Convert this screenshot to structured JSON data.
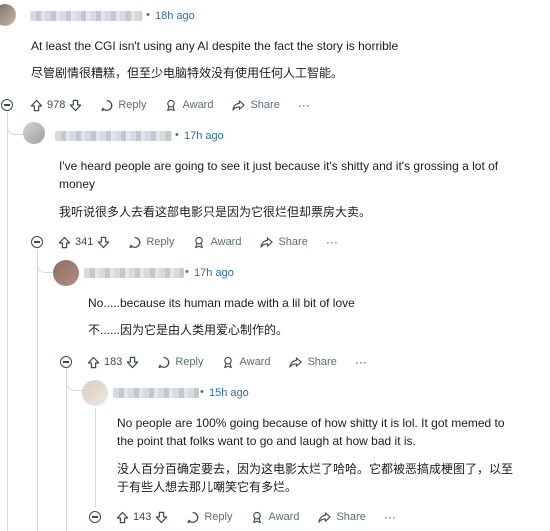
{
  "comments": [
    {
      "time": "18h ago",
      "lines": [
        "At least the CGI isn't using any AI despite the fact the story is horrible"
      ],
      "translation": [
        "尽管剧情很糟糕，但至少电脑特效没有使用任何人工智能。"
      ],
      "votes": "978",
      "reply_label": "Reply",
      "award_label": "Award",
      "share_label": "Share",
      "more_label": "···"
    },
    {
      "time": "17h ago",
      "lines": [
        "I've heard people are going to see it just because it's shitty and it's grossing a lot of",
        "money"
      ],
      "translation": [
        "我听说很多人去看这部电影只是因为它很烂但却票房大卖。"
      ],
      "votes": "341",
      "reply_label": "Reply",
      "award_label": "Award",
      "share_label": "Share",
      "more_label": "···"
    },
    {
      "time": "17h ago",
      "lines": [
        "No.....because its human made with a lil bit of love"
      ],
      "translation": [
        "不......因为它是由人类用爱心制作的。"
      ],
      "votes": "183",
      "reply_label": "Reply",
      "award_label": "Award",
      "share_label": "Share",
      "more_label": "···"
    },
    {
      "time": "15h ago",
      "lines": [
        "No people are 100% going because of how shitty it is lol. It got memed to",
        "the point that folks want to go and laugh at how bad it is."
      ],
      "translation": [
        "没人百分百确定要去，因为这电影太烂了哈哈。它都被恶搞成梗图了，以至",
        "于有些人想去那儿嘲笑它有多烂。"
      ],
      "votes": "143",
      "reply_label": "Reply",
      "award_label": "Award",
      "share_label": "Share",
      "more_label": "···"
    }
  ],
  "colors": {
    "link_time": "#2a6fb0",
    "meta": "#576f76",
    "thread": "#d5dadc"
  },
  "icons": [
    "upvote-icon",
    "downvote-icon",
    "reply-icon",
    "award-icon",
    "share-icon",
    "collapse-icon"
  ]
}
